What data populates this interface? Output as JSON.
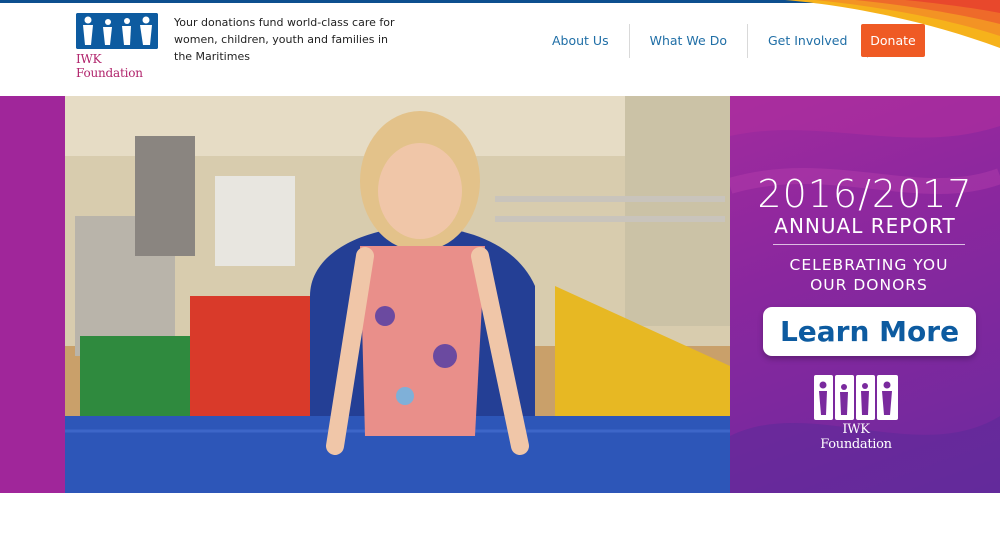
{
  "header": {
    "logo_text": "IWK Foundation",
    "tagline": "Your donations fund world-class care for women, children, youth and families in the Maritimes",
    "nav": [
      "About Us",
      "What We Do",
      "Get Involved"
    ],
    "donate_label": "Donate"
  },
  "hero": {
    "photo_alt": "Child smiling on a gym mat",
    "year": "2016/2017",
    "report_label": "ANNUAL REPORT",
    "celebrate_line1": "CELEBRATING YOU",
    "celebrate_line2": "OUR DONORS",
    "learn_more_label": "Learn More",
    "logo_text": "IWK Foundation"
  },
  "colors": {
    "brand_blue": "#0d5ba0",
    "brand_magenta": "#a0269a",
    "donate_orange": "#ef5a24"
  }
}
